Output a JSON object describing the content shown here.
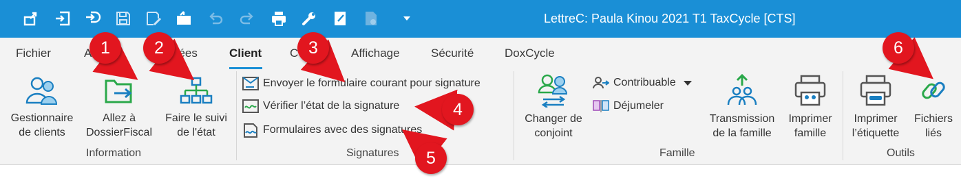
{
  "window": {
    "title": "LettreC: Paula Kinou 2021 T1 TaxCycle [CTS]"
  },
  "tabs": [
    {
      "label": "Fichier"
    },
    {
      "label": "A"
    },
    {
      "label": "nées"
    },
    {
      "label": "Client"
    },
    {
      "label": "C"
    },
    {
      "label": "Affichage"
    },
    {
      "label": "Sécurité"
    },
    {
      "label": "DoxCycle"
    }
  ],
  "information": {
    "group_label": "Information",
    "gestionnaire": {
      "line1": "Gestionnaire",
      "line2": "de clients"
    },
    "allez": {
      "line1": "Allez à",
      "line2": "DossierFiscal"
    },
    "suivi": {
      "line1": "Faire le suivi",
      "line2": "de l'état"
    }
  },
  "signatures": {
    "group_label": "Signatures",
    "envoyer": "Envoyer le formulaire courant pour signature",
    "verifier": "Vérifier l’état de la signature",
    "formulaires": "Formulaires avec des signatures"
  },
  "famille": {
    "group_label": "Famille",
    "changer": {
      "line1": "Changer de",
      "line2": "conjoint"
    },
    "contribuable": "Contribuable",
    "dejumeler": "Déjumeler",
    "transmission": {
      "line1": "Transmission",
      "line2": "de la famille"
    },
    "imprimer_famille": {
      "line1": "Imprimer",
      "line2": "famille"
    }
  },
  "outils": {
    "group_label": "Outils",
    "etiquette": {
      "line1": "Imprimer",
      "line2": "l’étiquette"
    },
    "fichiers": {
      "line1": "Fichiers",
      "line2": "liés"
    }
  },
  "callouts": [
    "1",
    "2",
    "3",
    "4",
    "5",
    "6"
  ],
  "colors": {
    "titlebar": "#1a8fd6",
    "badge": "#e2161f",
    "ribbon": "#f3f3f3",
    "icon_blue": "#1a7fc1",
    "icon_green": "#2aa84a"
  }
}
